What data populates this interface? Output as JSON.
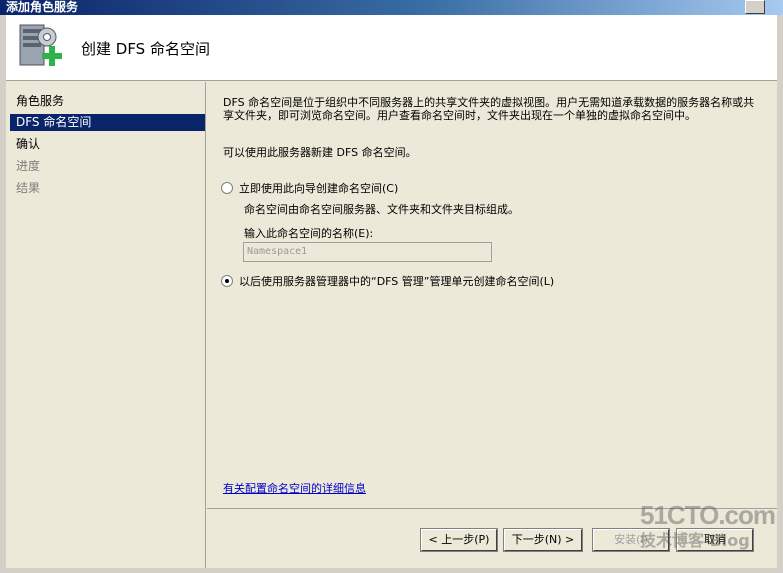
{
  "window": {
    "title": "添加角色服务"
  },
  "header": {
    "title": "创建 DFS 命名空间"
  },
  "nav": {
    "items": [
      {
        "label": "角色服务",
        "state": "normal"
      },
      {
        "label": "DFS 命名空间",
        "state": "active"
      },
      {
        "label": "确认",
        "state": "normal"
      },
      {
        "label": "进度",
        "state": "disabled"
      },
      {
        "label": "结果",
        "state": "disabled"
      }
    ]
  },
  "content": {
    "description": "DFS 命名空间是位于组织中不同服务器上的共享文件夹的虚拟视图。用户无需知道承载数据的服务器名称或共享文件夹，即可浏览命名空间。用户查看命名空间时，文件夹出现在一个单独的虚拟命名空间中。",
    "description2": "可以使用此服务器新建 DFS 命名空间。",
    "option_now": {
      "label": "立即使用此向导创建命名空间(C)",
      "checked": false
    },
    "option_now_desc": "命名空间由命名空间服务器、文件夹和文件夹目标组成。",
    "name_label": "输入此命名空间的名称(E):",
    "name_value": "Namespace1",
    "option_later": {
      "label": "以后使用服务器管理器中的“DFS 管理”管理单元创建命名空间(L)",
      "checked": true
    },
    "link": "有关配置命名空间的详细信息"
  },
  "buttons": {
    "prev": "< 上一步(P)",
    "next": "下一步(N) >",
    "install": "安装(I)",
    "cancel": "取消"
  },
  "watermark": {
    "line1": "51CTO.com",
    "line2": "技术博客 Blog"
  }
}
